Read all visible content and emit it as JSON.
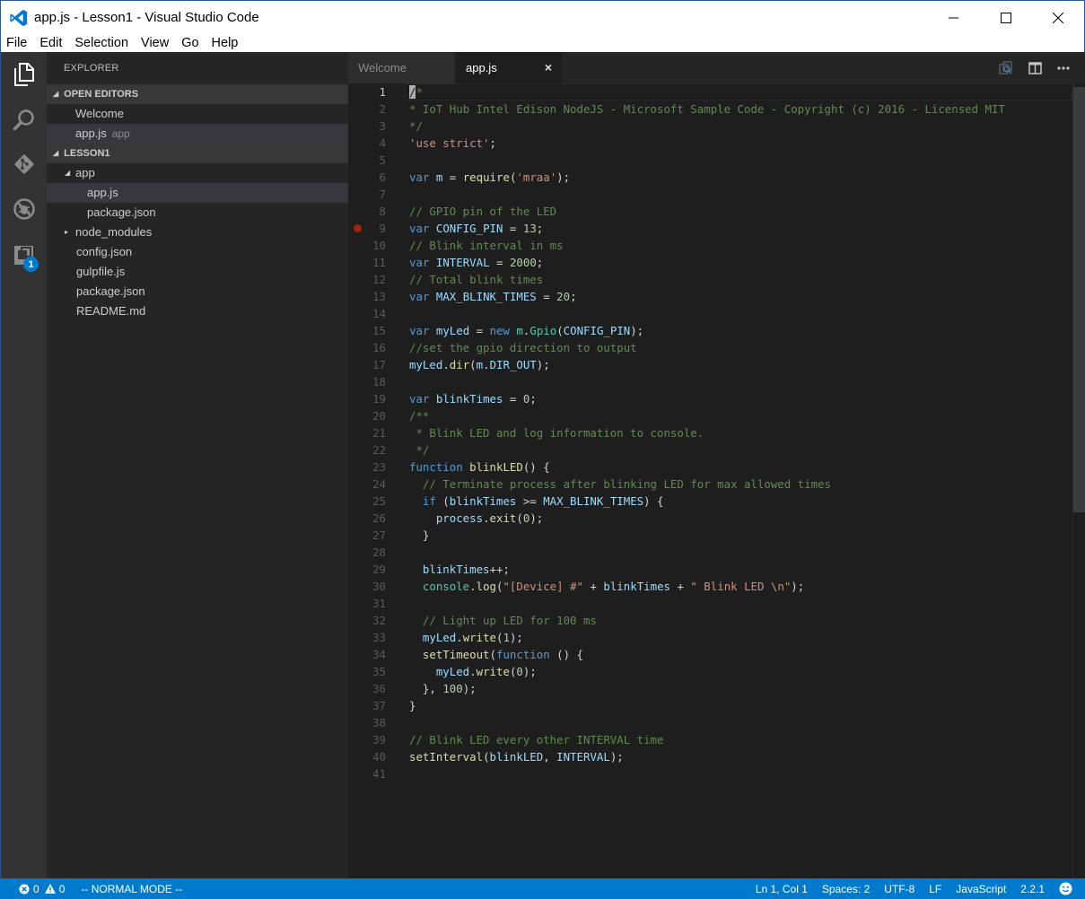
{
  "window": {
    "title": "app.js - Lesson1 - Visual Studio Code",
    "controls": {
      "minimize": "—",
      "maximize": "☐",
      "close": "✕"
    }
  },
  "menu": [
    "File",
    "Edit",
    "Selection",
    "View",
    "Go",
    "Help"
  ],
  "activity_bar": {
    "items": [
      {
        "name": "explorer",
        "icon": "files-icon",
        "active": true
      },
      {
        "name": "search",
        "icon": "search-icon"
      },
      {
        "name": "git",
        "icon": "git-icon"
      },
      {
        "name": "debug",
        "icon": "debug-icon"
      },
      {
        "name": "extensions",
        "icon": "extensions-icon",
        "badge": "1"
      }
    ]
  },
  "sidebar": {
    "title": "EXPLORER",
    "open_editors": {
      "label": "OPEN EDITORS",
      "items": [
        {
          "name": "Welcome",
          "desc": ""
        },
        {
          "name": "app.js",
          "desc": "app",
          "selected": true
        }
      ]
    },
    "project": {
      "label": "LESSON1",
      "tree": [
        {
          "name": "app",
          "type": "folder",
          "expanded": true,
          "depth": 1
        },
        {
          "name": "app.js",
          "type": "file",
          "depth": 2,
          "selected": true
        },
        {
          "name": "package.json",
          "type": "file",
          "depth": 2
        },
        {
          "name": "node_modules",
          "type": "folder",
          "expanded": false,
          "depth": 1
        },
        {
          "name": "config.json",
          "type": "file",
          "depth": 1
        },
        {
          "name": "gulpfile.js",
          "type": "file",
          "depth": 1
        },
        {
          "name": "package.json",
          "type": "file",
          "depth": 1
        },
        {
          "name": "README.md",
          "type": "file",
          "depth": 1
        }
      ]
    }
  },
  "tabs": [
    {
      "label": "Welcome",
      "active": false
    },
    {
      "label": "app.js",
      "active": true,
      "close": "×"
    }
  ],
  "tab_actions": [
    "open-changes-icon",
    "split-editor-icon",
    "more-actions-icon"
  ],
  "editor": {
    "current_line": 1,
    "breakpoint_lines": [
      9
    ],
    "lines": [
      [
        [
          "com",
          "/*"
        ]
      ],
      [
        [
          "com",
          "* IoT Hub Intel Edison NodeJS - Microsoft Sample Code - Copyright (c) 2016 - Licensed MIT"
        ]
      ],
      [
        [
          "com",
          "*/"
        ]
      ],
      [
        [
          "str",
          "'use strict'"
        ],
        [
          "plain",
          ";"
        ]
      ],
      [],
      [
        [
          "kw",
          "var"
        ],
        [
          "plain",
          " "
        ],
        [
          "var",
          "m"
        ],
        [
          "plain",
          " = "
        ],
        [
          "fn",
          "require"
        ],
        [
          "plain",
          "("
        ],
        [
          "str",
          "'mraa'"
        ],
        [
          "plain",
          ");"
        ]
      ],
      [],
      [
        [
          "com",
          "// GPIO pin of the LED"
        ]
      ],
      [
        [
          "kw",
          "var"
        ],
        [
          "plain",
          " "
        ],
        [
          "var",
          "CONFIG_PIN"
        ],
        [
          "plain",
          " = "
        ],
        [
          "num",
          "13"
        ],
        [
          "plain",
          ";"
        ]
      ],
      [
        [
          "com",
          "// Blink interval in ms"
        ]
      ],
      [
        [
          "kw",
          "var"
        ],
        [
          "plain",
          " "
        ],
        [
          "var",
          "INTERVAL"
        ],
        [
          "plain",
          " = "
        ],
        [
          "num",
          "2000"
        ],
        [
          "plain",
          ";"
        ]
      ],
      [
        [
          "com",
          "// Total blink times"
        ]
      ],
      [
        [
          "kw",
          "var"
        ],
        [
          "plain",
          " "
        ],
        [
          "var",
          "MAX_BLINK_TIMES"
        ],
        [
          "plain",
          " = "
        ],
        [
          "num",
          "20"
        ],
        [
          "plain",
          ";"
        ]
      ],
      [],
      [
        [
          "kw",
          "var"
        ],
        [
          "plain",
          " "
        ],
        [
          "var",
          "myLed"
        ],
        [
          "plain",
          " = "
        ],
        [
          "kw",
          "new"
        ],
        [
          "plain",
          " "
        ],
        [
          "type",
          "m"
        ],
        [
          "plain",
          "."
        ],
        [
          "type",
          "Gpio"
        ],
        [
          "plain",
          "("
        ],
        [
          "var",
          "CONFIG_PIN"
        ],
        [
          "plain",
          ");"
        ]
      ],
      [
        [
          "com",
          "//set the gpio direction to output"
        ]
      ],
      [
        [
          "var",
          "myLed"
        ],
        [
          "plain",
          "."
        ],
        [
          "fn",
          "dir"
        ],
        [
          "plain",
          "("
        ],
        [
          "var",
          "m"
        ],
        [
          "plain",
          "."
        ],
        [
          "var",
          "DIR_OUT"
        ],
        [
          "plain",
          ");"
        ]
      ],
      [],
      [
        [
          "kw",
          "var"
        ],
        [
          "plain",
          " "
        ],
        [
          "var",
          "blinkTimes"
        ],
        [
          "plain",
          " = "
        ],
        [
          "num",
          "0"
        ],
        [
          "plain",
          ";"
        ]
      ],
      [
        [
          "com",
          "/**"
        ]
      ],
      [
        [
          "com",
          " * Blink LED and log information to console."
        ]
      ],
      [
        [
          "com",
          " */"
        ]
      ],
      [
        [
          "kw",
          "function"
        ],
        [
          "plain",
          " "
        ],
        [
          "fn",
          "blinkLED"
        ],
        [
          "plain",
          "() {"
        ]
      ],
      [
        [
          "plain",
          "  "
        ],
        [
          "com",
          "// Terminate process after blinking LED for max allowed times"
        ]
      ],
      [
        [
          "plain",
          "  "
        ],
        [
          "kw",
          "if"
        ],
        [
          "plain",
          " ("
        ],
        [
          "var",
          "blinkTimes"
        ],
        [
          "plain",
          " >= "
        ],
        [
          "var",
          "MAX_BLINK_TIMES"
        ],
        [
          "plain",
          ") {"
        ]
      ],
      [
        [
          "plain",
          "    "
        ],
        [
          "var",
          "process"
        ],
        [
          "plain",
          "."
        ],
        [
          "fn",
          "exit"
        ],
        [
          "plain",
          "("
        ],
        [
          "num",
          "0"
        ],
        [
          "plain",
          ");"
        ]
      ],
      [
        [
          "plain",
          "  }"
        ]
      ],
      [],
      [
        [
          "plain",
          "  "
        ],
        [
          "var",
          "blinkTimes"
        ],
        [
          "plain",
          "++;"
        ]
      ],
      [
        [
          "plain",
          "  "
        ],
        [
          "type",
          "console"
        ],
        [
          "plain",
          "."
        ],
        [
          "fn",
          "log"
        ],
        [
          "plain",
          "("
        ],
        [
          "str",
          "\"[Device] #\""
        ],
        [
          "plain",
          " + "
        ],
        [
          "var",
          "blinkTimes"
        ],
        [
          "plain",
          " + "
        ],
        [
          "str",
          "\" Blink LED \\n\""
        ],
        [
          "plain",
          ");"
        ]
      ],
      [],
      [
        [
          "plain",
          "  "
        ],
        [
          "com",
          "// Light up LED for 100 ms"
        ]
      ],
      [
        [
          "plain",
          "  "
        ],
        [
          "var",
          "myLed"
        ],
        [
          "plain",
          "."
        ],
        [
          "fn",
          "write"
        ],
        [
          "plain",
          "("
        ],
        [
          "num",
          "1"
        ],
        [
          "plain",
          ");"
        ]
      ],
      [
        [
          "plain",
          "  "
        ],
        [
          "fn",
          "setTimeout"
        ],
        [
          "plain",
          "("
        ],
        [
          "kw",
          "function"
        ],
        [
          "plain",
          " () {"
        ]
      ],
      [
        [
          "plain",
          "    "
        ],
        [
          "var",
          "myLed"
        ],
        [
          "plain",
          "."
        ],
        [
          "fn",
          "write"
        ],
        [
          "plain",
          "("
        ],
        [
          "num",
          "0"
        ],
        [
          "plain",
          ");"
        ]
      ],
      [
        [
          "plain",
          "  }, "
        ],
        [
          "num",
          "100"
        ],
        [
          "plain",
          ");"
        ]
      ],
      [
        [
          "plain",
          "}"
        ]
      ],
      [],
      [
        [
          "com",
          "// Blink LED every other INTERVAL time"
        ]
      ],
      [
        [
          "fn",
          "setInterval"
        ],
        [
          "plain",
          "("
        ],
        [
          "var",
          "blinkLED"
        ],
        [
          "plain",
          ", "
        ],
        [
          "var",
          "INTERVAL"
        ],
        [
          "plain",
          ");"
        ]
      ],
      []
    ]
  },
  "statusbar": {
    "errors": "0",
    "warnings": "0",
    "mode": "-- NORMAL MODE --",
    "position": "Ln 1, Col 1",
    "indent": "Spaces: 2",
    "encoding": "UTF-8",
    "eol": "LF",
    "language": "JavaScript",
    "version": "2.2.1",
    "feedback_icon": "smiley-icon"
  },
  "colors": {
    "accent": "#007acc",
    "breakpoint": "#a1260d"
  }
}
